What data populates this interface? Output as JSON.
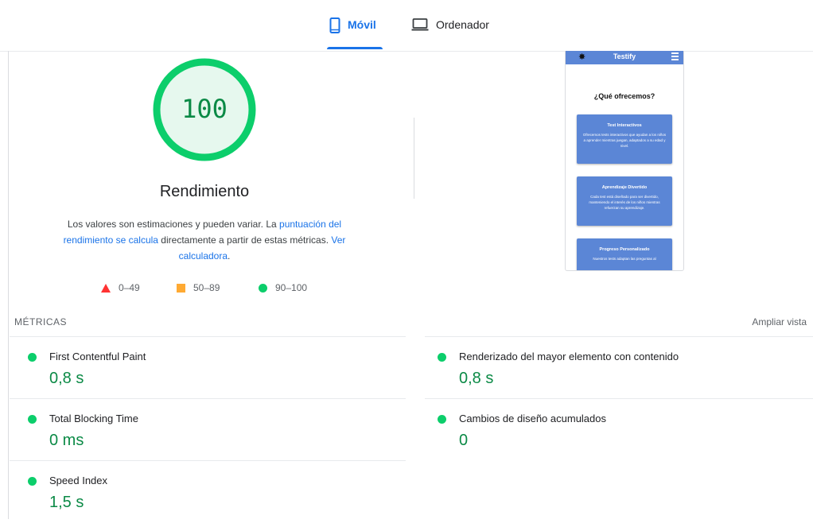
{
  "tabs": [
    {
      "label": "Móvil",
      "icon": "smartphone-icon",
      "active": true
    },
    {
      "label": "Ordenador",
      "icon": "laptop-icon",
      "active": false
    }
  ],
  "gauge": {
    "value": "100",
    "score": 100,
    "title": "Rendimiento"
  },
  "description": {
    "text1": "Los valores son estimaciones y pueden variar. La ",
    "link1": "puntuación del rendimiento se calcula",
    "text2": " directamente a partir de estas métricas. ",
    "link2": "Ver calculadora",
    "text3": "."
  },
  "legend": [
    {
      "range": "0–49",
      "icon": "red-triangle-icon"
    },
    {
      "range": "50–89",
      "icon": "orange-square-icon"
    },
    {
      "range": "90–100",
      "icon": "green-circle-icon"
    }
  ],
  "preview": {
    "site_title": "Testify",
    "heading": "¿Qué ofrecemos?",
    "cards": [
      {
        "title": "Test Interactivos",
        "body": "Ofrecemos tests interactivos que ayudan a los niños a aprender mientras juegan, adaptados a su edad y nivel."
      },
      {
        "title": "Aprendizaje Divertido",
        "body": "Cada test está diseñado para ser divertido, manteniendo el interés de los niños mientras refuerzan su aprendizaje."
      },
      {
        "title": "Progreso Personalizado",
        "body": "Nuestros tests adaptan las preguntas al"
      }
    ]
  },
  "metrics_header": "MÉTRICAS",
  "expand_label": "Ampliar vista",
  "metrics": [
    {
      "name": "First Contentful Paint",
      "value": "0,8 s"
    },
    {
      "name": "Renderizado del mayor elemento con contenido",
      "value": "0,8 s"
    },
    {
      "name": "Total Blocking Time",
      "value": "0 ms"
    },
    {
      "name": "Cambios de diseño acumulados",
      "value": "0"
    },
    {
      "name": "Speed Index",
      "value": "1,5 s"
    }
  ],
  "colors": {
    "accent": "#1a73e8",
    "pass": "#0cce6b",
    "pass_text": "#0b8a46",
    "average": "#ffaa33",
    "fail": "#ff3333"
  }
}
